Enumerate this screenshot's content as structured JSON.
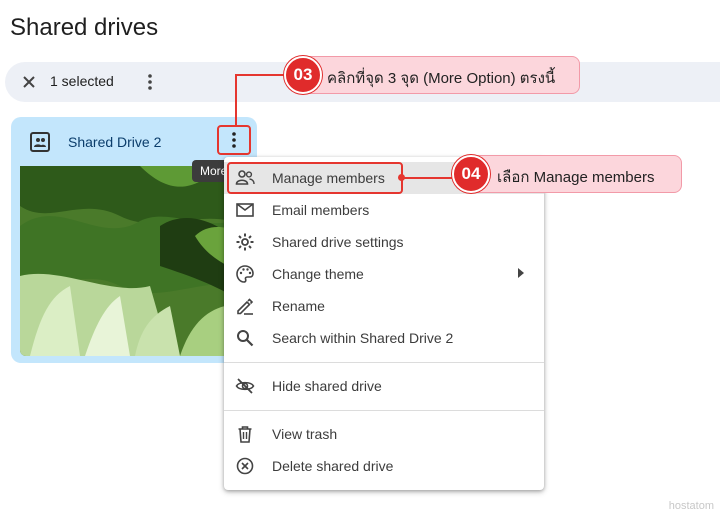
{
  "page": {
    "title": "Shared drives"
  },
  "selection_bar": {
    "count_label": "1 selected"
  },
  "drive_card": {
    "title": "Shared Drive 2",
    "tooltip": "More"
  },
  "menu": {
    "items": [
      {
        "label": "Manage members",
        "icon": "manage-members-icon"
      },
      {
        "label": "Email members",
        "icon": "mail-icon"
      },
      {
        "label": "Shared drive settings",
        "icon": "gear-icon"
      },
      {
        "label": "Change theme",
        "icon": "palette-icon"
      },
      {
        "label": "Rename",
        "icon": "rename-pencil-icon"
      },
      {
        "label": "Search within Shared Drive 2",
        "icon": "search-icon"
      },
      {
        "label": "Hide shared drive",
        "icon": "eye-off-icon"
      },
      {
        "label": "View trash",
        "icon": "trash-icon"
      },
      {
        "label": "Delete shared drive",
        "icon": "delete-circle-icon"
      }
    ]
  },
  "annotations": [
    {
      "number": "03",
      "text": "คลิกที่จุด 3 จุด (More Option) ตรงนี้"
    },
    {
      "number": "04",
      "text": "เลือก Manage members"
    }
  ],
  "watermark": "hostatom",
  "colors": {
    "accent_red": "#e02b2b",
    "callout_bg": "#fcd6dc",
    "card_bg": "#c3e6fc",
    "selection_bar_bg": "#edf0f6"
  }
}
